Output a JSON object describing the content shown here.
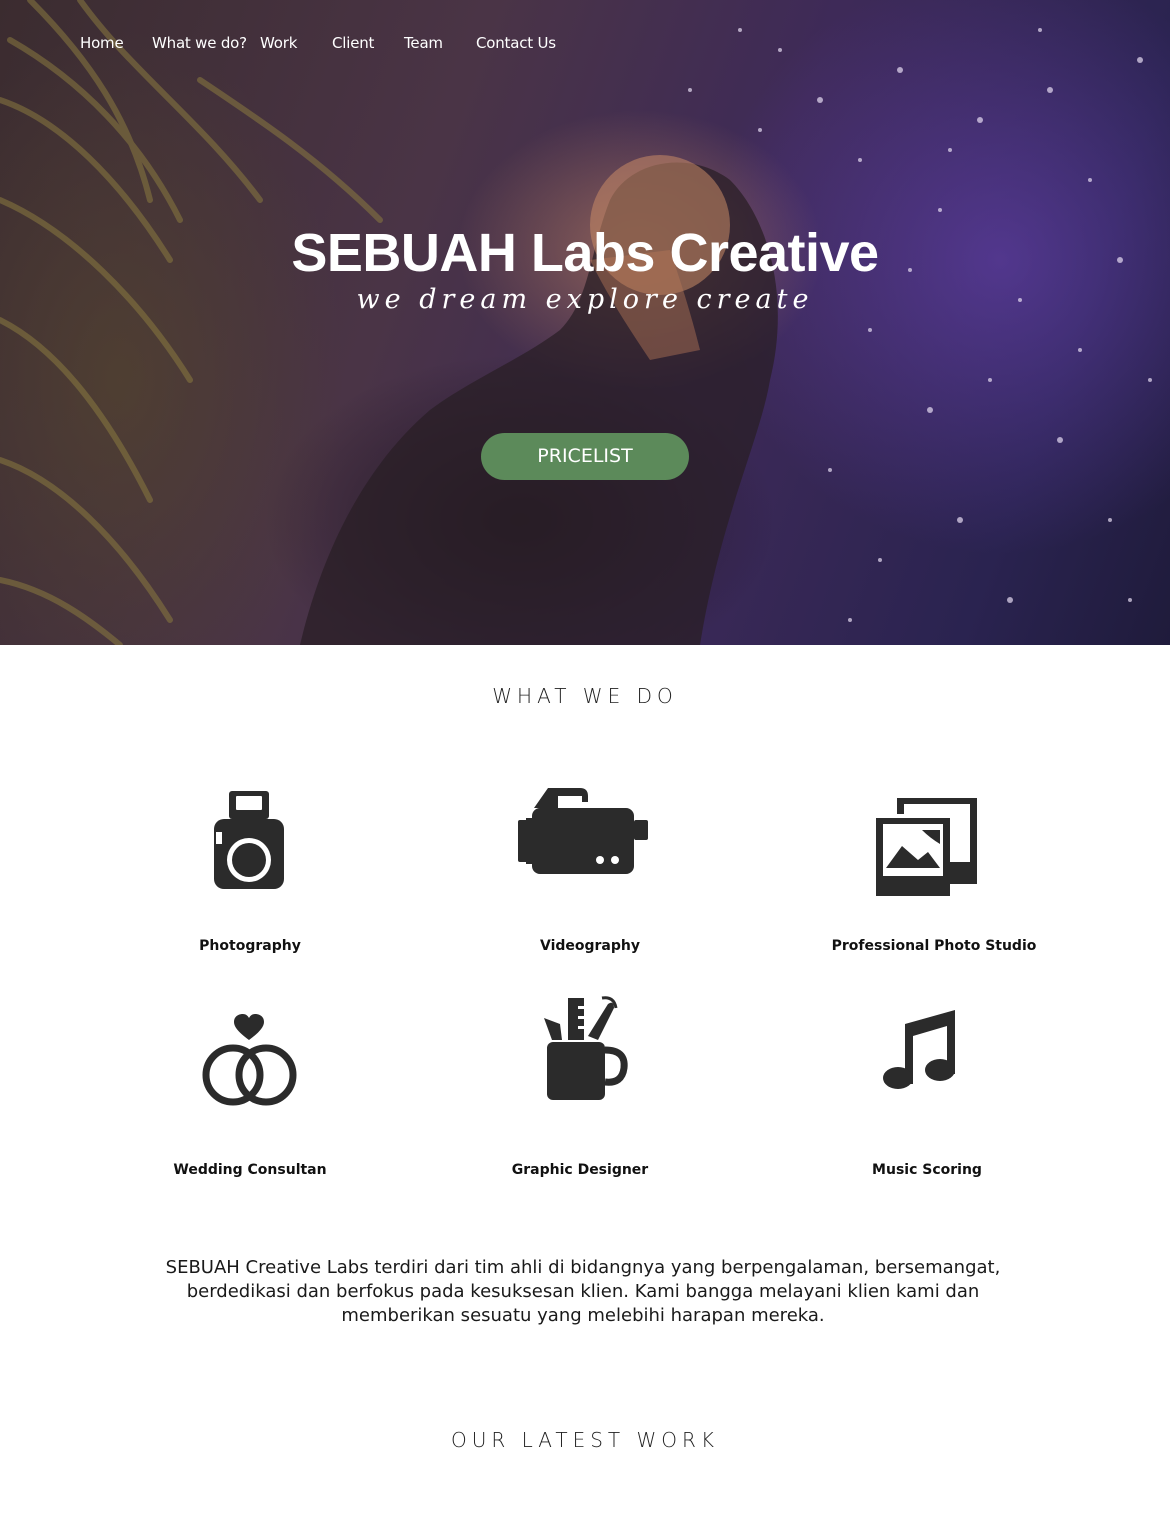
{
  "nav": {
    "items": [
      {
        "label": "Home"
      },
      {
        "label": "What we do?"
      },
      {
        "label": "Work"
      },
      {
        "label": "Client"
      },
      {
        "label": "Team"
      },
      {
        "label": "Contact Us"
      }
    ]
  },
  "hero": {
    "title": "SEBUAH Labs Creative",
    "tagline": "we dream explore create",
    "button_label": "PRICELIST",
    "button_color": "#5c8a5a"
  },
  "what_we_do": {
    "heading": "WHAT WE DO",
    "services": [
      {
        "label": "Photography",
        "icon": "camera-icon"
      },
      {
        "label": "Videography",
        "icon": "video-camera-icon"
      },
      {
        "label": "Professional Photo Studio",
        "icon": "photo-gallery-icon"
      },
      {
        "label": "Wedding Consultan",
        "icon": "wedding-rings-icon"
      },
      {
        "label": "Graphic Designer",
        "icon": "design-tools-mug-icon"
      },
      {
        "label": "Music Scoring",
        "icon": "music-note-icon"
      }
    ],
    "description": "SEBUAH Creative Labs terdiri dari tim ahli di bidangnya yang berpengalaman, bersemangat, berdedikasi dan berfokus pada kesuksesan klien. Kami bangga melayani klien kami dan memberikan sesuatu yang melebihi harapan mereka."
  },
  "latest_work": {
    "heading": "OUR LATEST WORK"
  }
}
